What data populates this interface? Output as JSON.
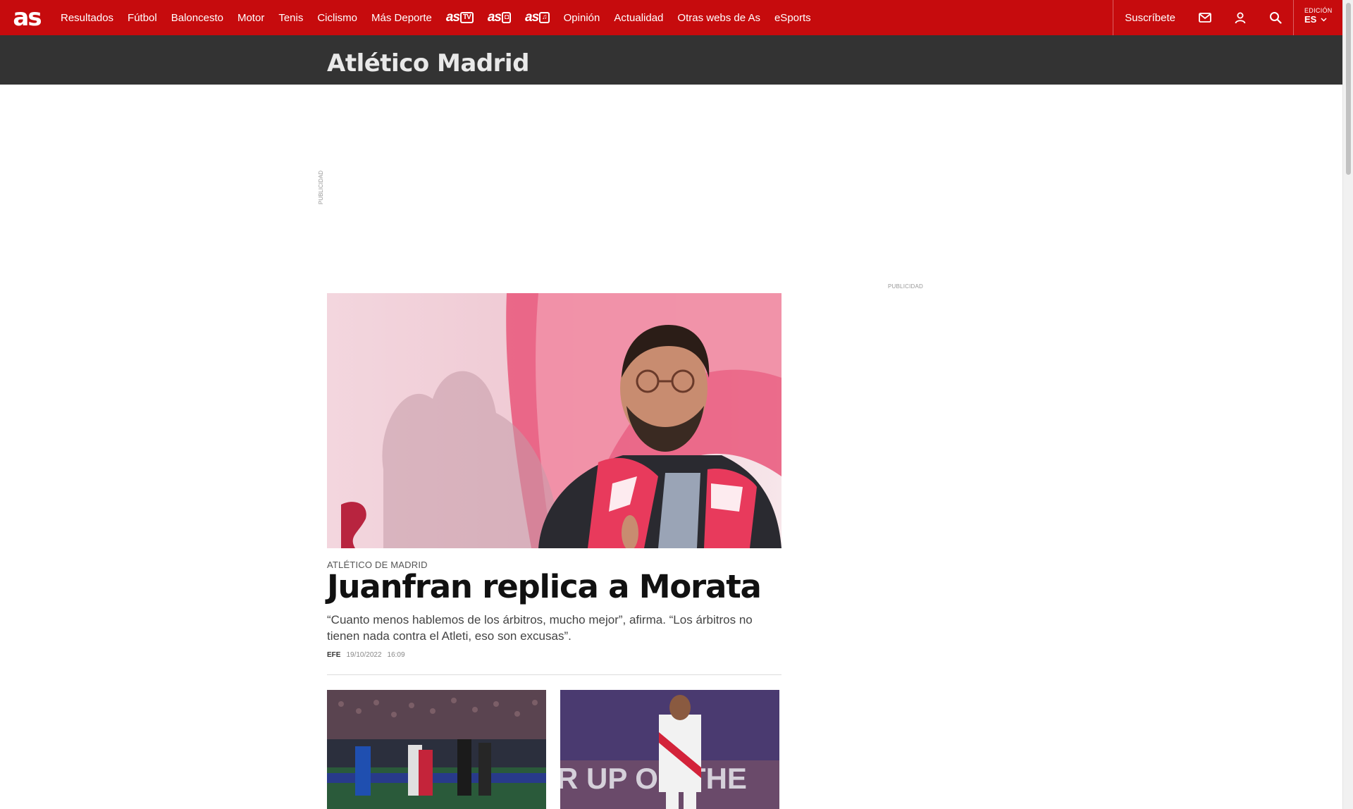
{
  "header": {
    "logo_text": "as",
    "nav": [
      {
        "label": "Resultados"
      },
      {
        "label": "Fútbol"
      },
      {
        "label": "Baloncesto"
      },
      {
        "label": "Motor"
      },
      {
        "label": "Tenis"
      },
      {
        "label": "Ciclismo"
      },
      {
        "label": "Más Deporte"
      }
    ],
    "brands": [
      {
        "main": "as",
        "sub": "TV"
      },
      {
        "main": "as",
        "sub": "◘"
      },
      {
        "main": "as",
        "sub": "♫"
      }
    ],
    "nav2": [
      {
        "label": "Opinión"
      },
      {
        "label": "Actualidad"
      },
      {
        "label": "Otras webs de As"
      },
      {
        "label": "eSports"
      }
    ],
    "subscribe_label": "Suscríbete",
    "edition": {
      "label": "EDICIÓN",
      "value": "ES"
    },
    "icons": [
      "mail-icon",
      "user-icon",
      "search-icon"
    ],
    "brand_color": "#c60b0d"
  },
  "section": {
    "title": "Atlético Madrid"
  },
  "ads": {
    "label": "PUBLICIDAD"
  },
  "main_story": {
    "kicker": "ATLÉTICO DE MADRID",
    "headline": "Juanfran replica a Morata",
    "summary": "“Cuanto menos hablemos de los árbitros, mucho mejor”, afirma. “Los árbitros no tienen nada contra el Atleti, eso son excusas”.",
    "author": "EFE",
    "date": "19/10/2022",
    "time": "16:09"
  }
}
